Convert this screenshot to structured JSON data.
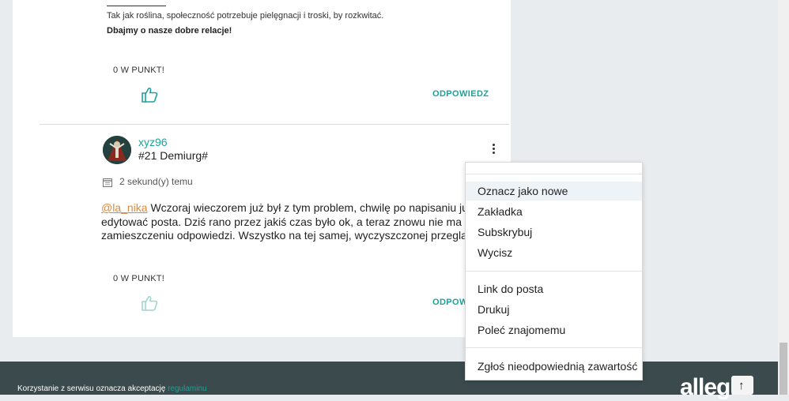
{
  "post1": {
    "signature_line1": "Tak jak roślina, społeczność potrzebuje pielęgnacji i troski, by rozkwitać.",
    "signature_line2": "Dbajmy o nasze dobre relacje!",
    "points": "0 W PUNKT!",
    "reply_label": "ODPOWIEDZ"
  },
  "post2": {
    "username": "xyz96",
    "rank": "#21 Demiurg#",
    "date": "2 sekund(y) temu",
    "mention": "@la_nika",
    "line1_rest": " Wczoraj wieczorem już był z tym problem, chwilę po napisaniu już nie da",
    "line2": "edytować posta. Dziś rano przez jakiś czas było ok, a teraz znowu nie ma edycji zan",
    "line3": "zamieszczeniu odpowiedzi. Wszystko na tej samej, wyczyszczonej przeglądarce.",
    "points": "0 W PUNKT!",
    "reply_label": "ODPOW"
  },
  "menu": {
    "items": [
      {
        "label": "Oznacz jako nowe"
      },
      {
        "label": "Zakładka"
      },
      {
        "label": "Subskrybuj"
      },
      {
        "label": "Wycisz"
      },
      {
        "label": "Link do posta"
      },
      {
        "label": "Drukuj"
      },
      {
        "label": "Poleć znajomemu"
      },
      {
        "label": "Zgłoś nieodpowiednią zawartość"
      }
    ]
  },
  "footer": {
    "text": "Korzystanie z serwisu oznacza akceptację ",
    "link": "regulaminu",
    "brand": "allegro"
  },
  "colors": {
    "accent": "#1aa39a",
    "mention": "#e0883a",
    "footer_bg": "#3a4a4d",
    "page_bg": "#e8ecee"
  },
  "icons": [
    "thumbs-up-icon",
    "calendar-icon",
    "kebab-menu-icon",
    "arrow-up-icon"
  ]
}
